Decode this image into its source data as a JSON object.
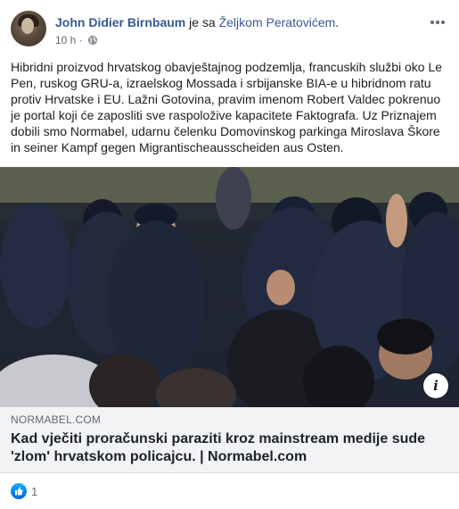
{
  "post": {
    "author": "John Didier Birnbaum",
    "with_text": " je sa ",
    "tagged": "Željkom Peratovićem",
    "tagged_suffix": ".",
    "time": "10 h",
    "separator": "·",
    "privacy_icon": "globe-icon",
    "text": "Hibridni proizvod hrvatskog obavještajnog podzemlja, francuskih službi oko Le Pen, ruskog GRU-a, izraelskog Mossada i srbijanske BIA-e u hibridnom ratu protiv Hrvatske i EU. Lažni Gotovina, pravim imenom Robert Valdec pokrenuo je portal koji će zaposliti sve raspoložive kapacitete Faktografa. Uz Priznajem dobili smo Normabel, udarnu čelenku Domovinskog parkinga Miroslava Škore in seiner Kampf gegen Migrantischeausscheiden aus Osten."
  },
  "link": {
    "domain": "NORMABEL.COM",
    "title": "Kad vječiti proračunski paraziti kroz mainstream medije sude 'zlom' hrvatskom policajcu. | Normabel.com",
    "info_label": "i"
  },
  "reactions": {
    "count": "1",
    "icon": "like-icon"
  },
  "colors": {
    "link_blue": "#385898",
    "meta_gray": "#616770",
    "card_bg": "#f2f3f5",
    "like_blue": "#1877f2"
  }
}
